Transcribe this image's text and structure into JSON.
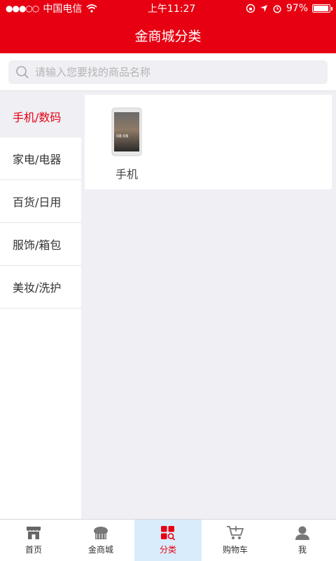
{
  "status_bar": {
    "signal": "●●●○○",
    "carrier": "中国电信",
    "time": "上午11:27",
    "battery_percent": "97%",
    "battery_level": 0.97
  },
  "header": {
    "title": "金商城分类"
  },
  "search": {
    "placeholder": "请输入您要找的商品名称"
  },
  "sidebar": {
    "items": [
      {
        "label": "手机/数码",
        "active": true
      },
      {
        "label": "家电/电器"
      },
      {
        "label": "百货/日用"
      },
      {
        "label": "服饰/箱包"
      },
      {
        "label": "美妆/洗护"
      }
    ]
  },
  "content": {
    "products": [
      {
        "label": "手机",
        "screen_time": "08:08"
      }
    ]
  },
  "tabbar": {
    "items": [
      {
        "label": "首页",
        "icon": "home-icon"
      },
      {
        "label": "金商城",
        "icon": "cake-icon"
      },
      {
        "label": "分类",
        "icon": "category-icon",
        "active": true
      },
      {
        "label": "购物车",
        "icon": "cart-icon"
      },
      {
        "label": "我",
        "icon": "user-icon"
      }
    ]
  },
  "colors": {
    "brand": "#e60012",
    "active_tab_bg": "#d9ecfb",
    "page_bg": "#efeff4"
  }
}
